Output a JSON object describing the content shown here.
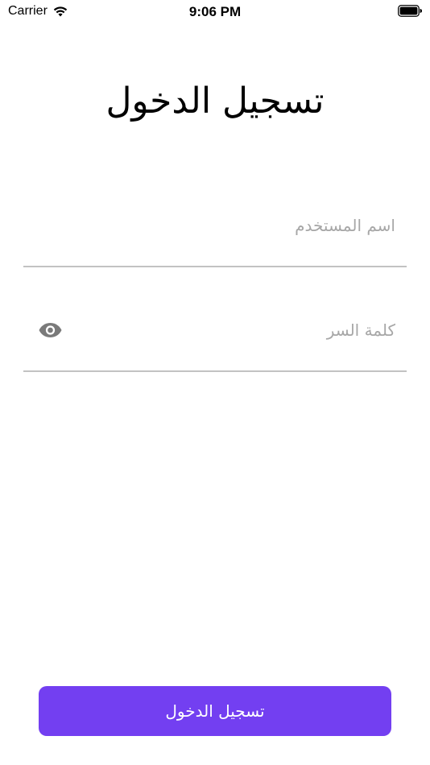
{
  "status_bar": {
    "carrier": "Carrier",
    "time": "9:06 PM"
  },
  "login": {
    "title": "تسجيل الدخول",
    "username_placeholder": "اسم المستخدم",
    "password_placeholder": "كلمة السر",
    "submit_label": "تسجيل الدخول"
  },
  "icons": {
    "wifi": "wifi-icon",
    "battery": "battery-icon",
    "password_toggle": "eye-icon"
  },
  "colors": {
    "accent": "#733ff1",
    "placeholder": "#a7a7a7",
    "divider": "#c2c2c2",
    "icon_gray": "#7a7a7a"
  }
}
